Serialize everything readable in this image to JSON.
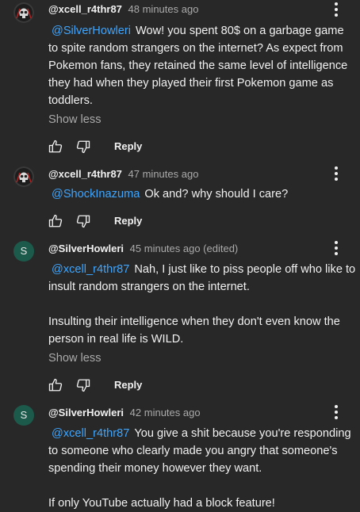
{
  "comments": [
    {
      "author": "@xcell_r4thr87",
      "time": "48 minutes ago",
      "mention": "@SilverHowleri",
      "paragraphs": [
        "Wow! you spent 80$ on a garbage game to spite random strangers on the internet? As expect from Pokemon fans, they retained the same level of intelligence they had when they played their first Pokemon game as toddlers."
      ],
      "show_less": "Show less",
      "reply_label": "Reply",
      "avatar_icon": "skull-avatar-icon"
    },
    {
      "author": "@xcell_r4thr87",
      "time": "47 minutes ago",
      "mention": "@ShockInazuma",
      "paragraphs": [
        "Ok and? why should I care?"
      ],
      "reply_label": "Reply",
      "avatar_icon": "skull-avatar-icon"
    },
    {
      "author": "@SilverHowleri",
      "time": "45 minutes ago (edited)",
      "mention": "@xcell_r4thr87",
      "paragraphs": [
        "Nah, I just like to piss people off who like to insult random strangers on the internet.",
        "Insulting their intelligence when they don't even know the person in real life is WILD."
      ],
      "show_less": "Show less",
      "reply_label": "Reply",
      "avatar_letter": "S",
      "avatar_color": "#1c5a4b"
    },
    {
      "author": "@SilverHowleri",
      "time": "42 minutes ago",
      "mention": "@xcell_r4thr87",
      "paragraphs": [
        "You give a shit because you're responding to someone who clearly made you angry that someone's spending their money however they want.",
        "If only YouTube actually had a block feature!"
      ],
      "avatar_letter": "S",
      "avatar_color": "#1c5a4b"
    }
  ],
  "colors": {
    "background": "#282828",
    "text": "#f1f1f1",
    "secondary_text": "#aaaaaa",
    "mention": "#3ea6ff"
  }
}
